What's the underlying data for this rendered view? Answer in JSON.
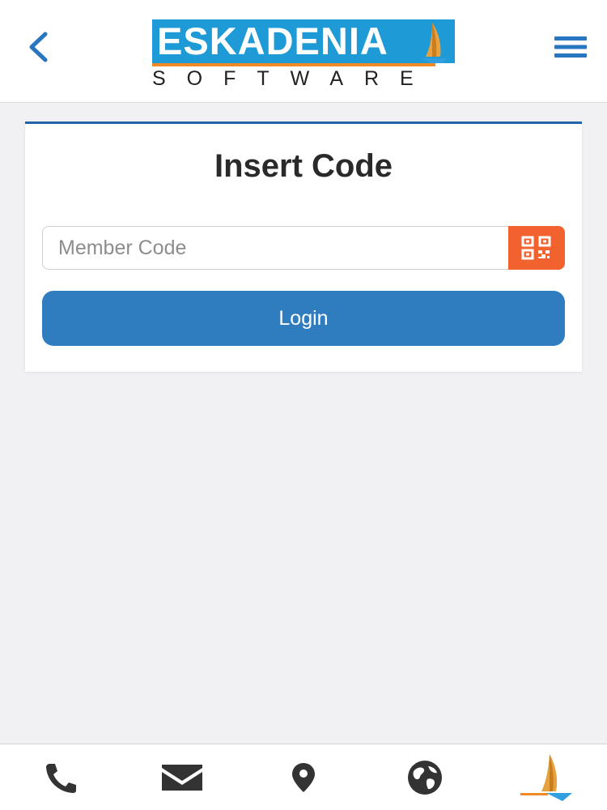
{
  "header": {
    "logo_text": "ESKADENIA",
    "logo_subtitle": "SOFTWARE",
    "back_icon": "chevron-left-icon",
    "menu_icon": "hamburger-menu-icon"
  },
  "card": {
    "title": "Insert Code",
    "member_code": {
      "value": "",
      "placeholder": "Member Code"
    },
    "qr_icon": "qr-code-icon",
    "login_label": "Login"
  },
  "bottom_bar": {
    "items": [
      {
        "icon": "phone-icon"
      },
      {
        "icon": "envelope-icon"
      },
      {
        "icon": "map-pin-icon"
      },
      {
        "icon": "globe-icon"
      },
      {
        "icon": "sailboat-logo-icon"
      }
    ]
  },
  "colors": {
    "accent_blue": "#2f7cbf",
    "header_blue": "#1e9ad6",
    "card_border": "#2163a6",
    "qr_orange": "#f2622f",
    "logo_orange": "#f08a24",
    "background": "#f1f0f3"
  }
}
